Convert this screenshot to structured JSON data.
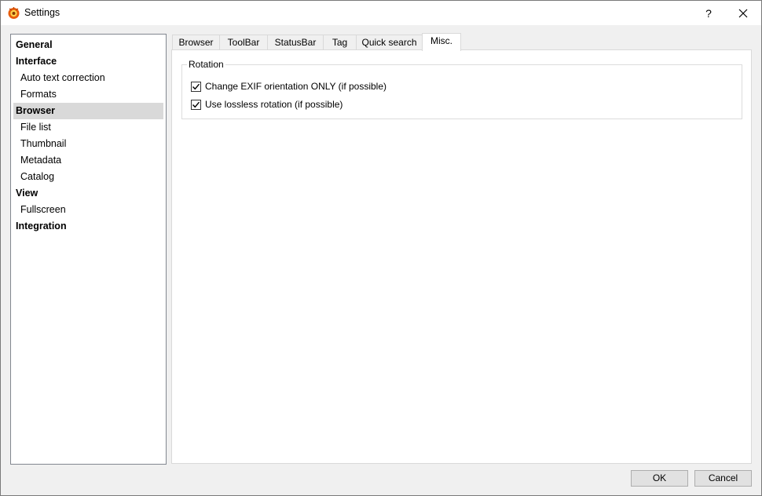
{
  "window": {
    "title": "Settings",
    "help_label": "?"
  },
  "sidebar": {
    "items": [
      {
        "label": "General",
        "level": 0
      },
      {
        "label": "Interface",
        "level": 0
      },
      {
        "label": "Auto text correction",
        "level": 1
      },
      {
        "label": "Formats",
        "level": 1
      },
      {
        "label": "Browser",
        "level": 0,
        "selected": true
      },
      {
        "label": "File list",
        "level": 1
      },
      {
        "label": "Thumbnail",
        "level": 1
      },
      {
        "label": "Metadata",
        "level": 1
      },
      {
        "label": "Catalog",
        "level": 1
      },
      {
        "label": "View",
        "level": 0
      },
      {
        "label": "Fullscreen",
        "level": 1
      },
      {
        "label": "Integration",
        "level": 0
      }
    ]
  },
  "tabs": [
    {
      "label": "Browser"
    },
    {
      "label": "ToolBar"
    },
    {
      "label": "StatusBar"
    },
    {
      "label": "Tag"
    },
    {
      "label": "Quick search"
    },
    {
      "label": "Misc.",
      "active": true
    }
  ],
  "rotation": {
    "legend": "Rotation",
    "options": [
      {
        "label": "Change EXIF orientation ONLY (if possible)",
        "checked": true
      },
      {
        "label": "Use lossless rotation (if possible)",
        "checked": true
      }
    ]
  },
  "footer": {
    "ok_label": "OK",
    "cancel_label": "Cancel"
  }
}
